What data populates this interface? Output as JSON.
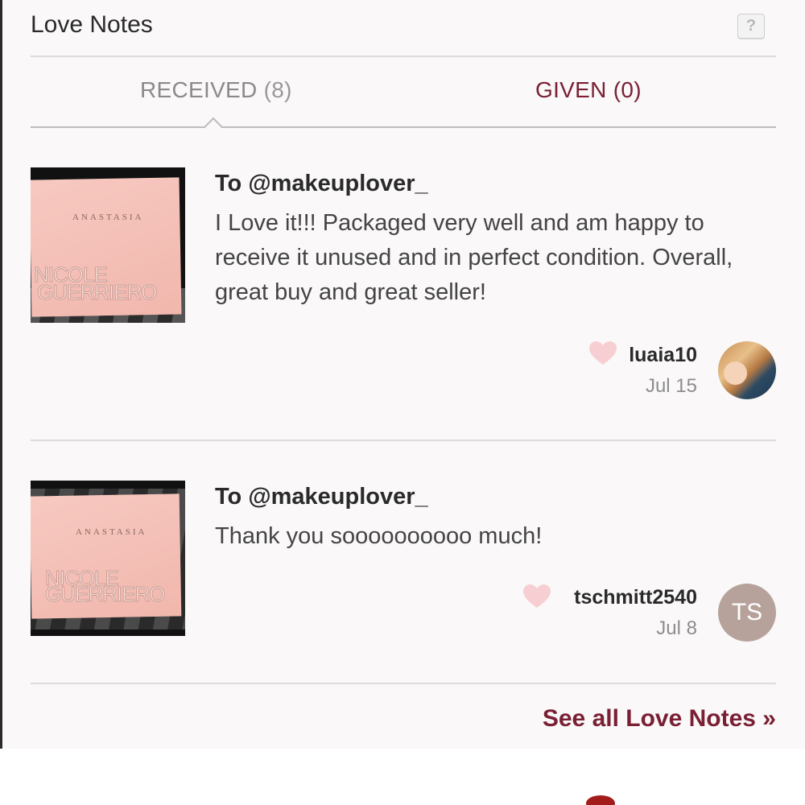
{
  "header": {
    "title": "Love Notes",
    "help_label": "?"
  },
  "tabs": {
    "received_label": "RECEIVED",
    "received_count": "(8)",
    "given_label": "GIVEN (0)"
  },
  "notes": [
    {
      "thumb_brand": "ANASTASIA",
      "thumb_name_line1": "NICOLE",
      "thumb_name_line2": "GUERRIERO",
      "to": "To @makeuplover_",
      "message": "I Love it!!! Packaged very well and am happy to receive it unused and in perfect condition. Overall, great buy and great seller!",
      "username": "luaia10",
      "date": "Jul 15",
      "avatar": "photo"
    },
    {
      "thumb_brand": "ANASTASIA",
      "thumb_name_line1": "NICOLE",
      "thumb_name_line2": "GUERRIERO",
      "to": "To @makeuplover_",
      "message": "Thank you soooooooooo much!",
      "username": "tschmitt2540",
      "date": "Jul 8",
      "avatar_initials": "TS"
    }
  ],
  "footer": {
    "see_all": "See all Love Notes »"
  },
  "colors": {
    "accent": "#7a2035",
    "heart": "#f7cfd3",
    "avatar_bg": "#b7a29b"
  }
}
